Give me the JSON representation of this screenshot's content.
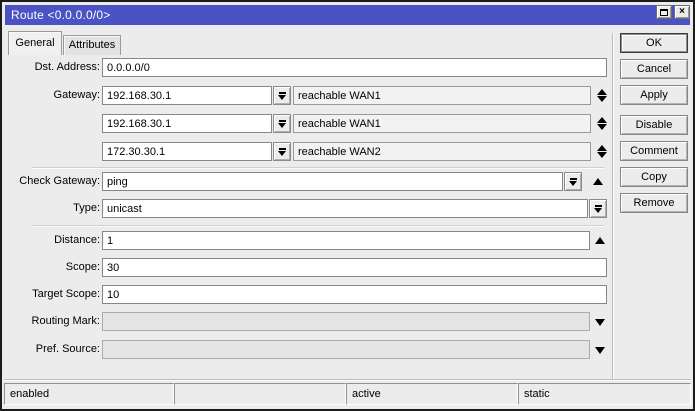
{
  "window": {
    "title": "Route <0.0.0.0/0>",
    "titlebar_color": "#4b52c4",
    "close_glyph": "×"
  },
  "tabs": [
    {
      "label": "General",
      "active": true
    },
    {
      "label": "Attributes",
      "active": false
    }
  ],
  "form": {
    "dst_address": {
      "label": "Dst. Address:",
      "value": "0.0.0.0/0"
    },
    "gateway_label": "Gateway:",
    "gateways": [
      {
        "value": "192.168.30.1",
        "status": "reachable WAN1"
      },
      {
        "value": "192.168.30.1",
        "status": "reachable WAN1"
      },
      {
        "value": "172.30.30.1",
        "status": "reachable WAN2"
      }
    ],
    "check_gateway": {
      "label": "Check Gateway:",
      "value": "ping"
    },
    "type": {
      "label": "Type:",
      "value": "unicast"
    },
    "distance": {
      "label": "Distance:",
      "value": "1"
    },
    "scope": {
      "label": "Scope:",
      "value": "30"
    },
    "target_scope": {
      "label": "Target Scope:",
      "value": "10"
    },
    "routing_mark": {
      "label": "Routing Mark:",
      "value": ""
    },
    "pref_source": {
      "label": "Pref. Source:",
      "value": ""
    }
  },
  "buttons": [
    "OK",
    "Cancel",
    "Apply",
    "Disable",
    "Comment",
    "Copy",
    "Remove"
  ],
  "statusbar": {
    "cells": [
      "enabled",
      "",
      "active",
      "static"
    ]
  }
}
